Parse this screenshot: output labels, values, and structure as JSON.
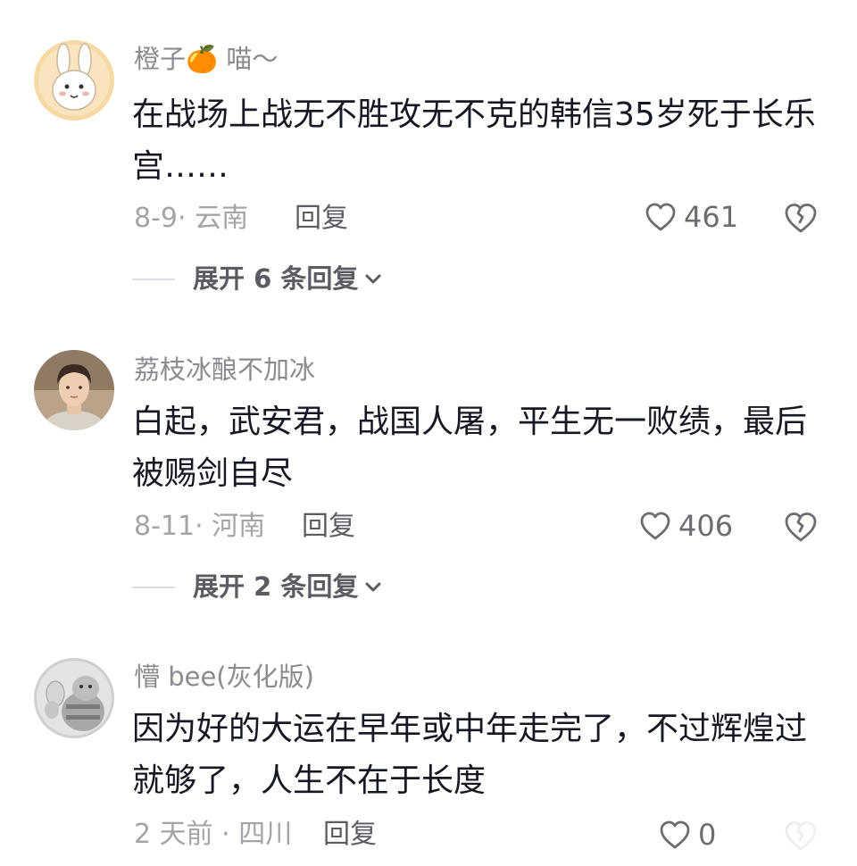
{
  "comments": [
    {
      "username": "橙子🍊 喵～",
      "text": "在战场上战无不胜攻无不克的韩信35岁死于长乐宫……",
      "date_location": "8-9· 云南",
      "reply_label": "回复",
      "likes": "461",
      "expand_label": "展开 6 条回复",
      "avatar_icon": "cartoon-rabbit-avatar"
    },
    {
      "username": "荔枝冰酿不加冰",
      "text": "白起，武安君，战国人屠，平生无一败绩，最后被赐剑自尽",
      "date_location": "8-11· 河南",
      "reply_label": "回复",
      "likes": "406",
      "expand_label": "展开 2 条回复",
      "avatar_icon": "person-photo-avatar"
    },
    {
      "username": "懵 bee(灰化版)",
      "text": "因为好的大运在早年或中年走完了，不过辉煌过就够了，人生不在于长度",
      "date_location": "2 天前 · 四川",
      "reply_label": "回复",
      "likes": "0",
      "avatar_icon": "grayscale-cartoon-avatar"
    }
  ],
  "colors": {
    "primary_text": "#161823",
    "secondary_text": "#8a8b91",
    "meta_text": "#a3a4a8"
  }
}
